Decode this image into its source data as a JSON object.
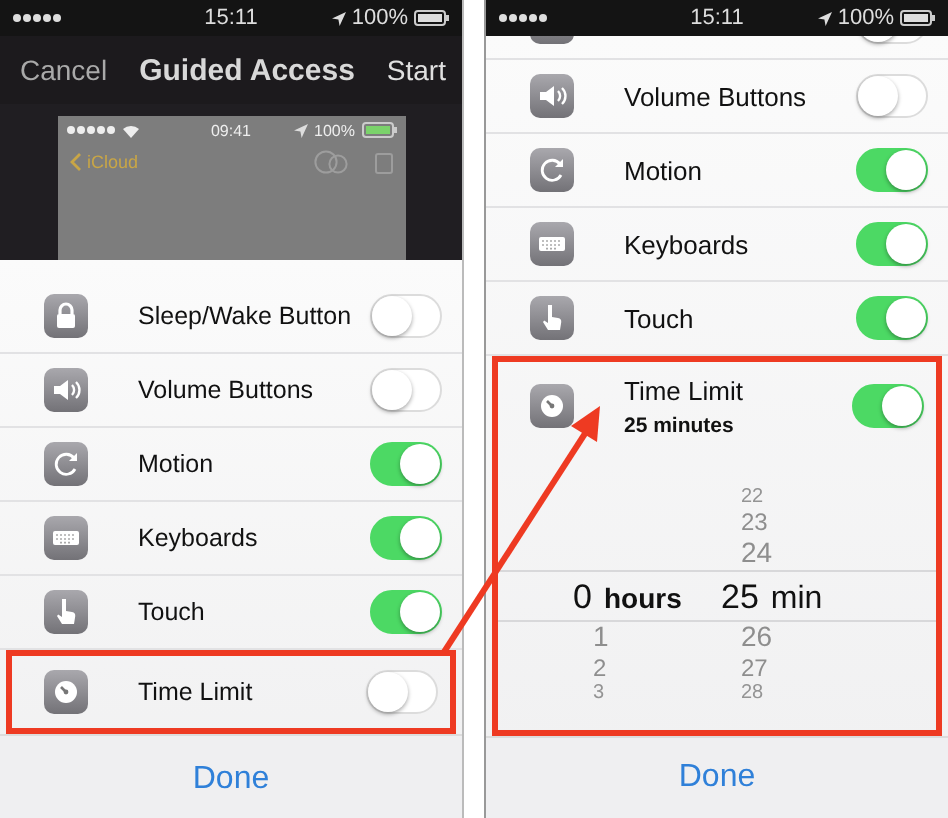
{
  "screens": [
    {
      "status_bar": {
        "time": "15:11",
        "battery": "100%"
      },
      "nav": {
        "cancel": "Cancel",
        "title": "Guided Access",
        "start": "Start"
      },
      "preview": {
        "status_bar": {
          "time": "09:41",
          "battery": "100%"
        },
        "back": "iCloud"
      },
      "scrolled": false,
      "options": [
        {
          "kind": "lock",
          "label": "Sleep/Wake Button",
          "on": false,
          "highlighted": false
        },
        {
          "kind": "speaker",
          "label": "Volume Buttons",
          "on": false,
          "highlighted": false
        },
        {
          "kind": "rotate",
          "label": "Motion",
          "on": true,
          "highlighted": false
        },
        {
          "kind": "keyboard",
          "label": "Keyboards",
          "on": true,
          "highlighted": false
        },
        {
          "kind": "hand",
          "label": "Touch",
          "on": true,
          "highlighted": false
        },
        {
          "kind": "timer",
          "label": "Time Limit",
          "on": false,
          "highlighted": true
        }
      ],
      "done": "Done"
    },
    {
      "status_bar": {
        "time": "15:11",
        "battery": "100%"
      },
      "scrolled": true,
      "options": [
        {
          "kind": "lock",
          "on": false,
          "highlighted": false
        },
        {
          "kind": "speaker",
          "label": "Volume Buttons",
          "on": false,
          "highlighted": false
        },
        {
          "kind": "rotate",
          "label": "Motion",
          "on": true,
          "highlighted": false
        },
        {
          "kind": "keyboard",
          "label": "Keyboards",
          "on": true,
          "highlighted": false
        },
        {
          "kind": "hand",
          "label": "Touch",
          "on": true,
          "highlighted": false
        },
        {
          "kind": "timer",
          "label": "Time Limit",
          "detail": "25 minutes",
          "on": true,
          "highlighted": true,
          "picker": {
            "hours": {
              "selected": "0",
              "unit": "hours",
              "below": [
                "1",
                "2",
                "3"
              ]
            },
            "minutes": {
              "above": [
                "22",
                "23",
                "24"
              ],
              "selected": "25",
              "unit": "min",
              "below": [
                "26",
                "27",
                "28"
              ]
            }
          }
        }
      ],
      "done": "Done"
    }
  ],
  "callout_arrow": true
}
